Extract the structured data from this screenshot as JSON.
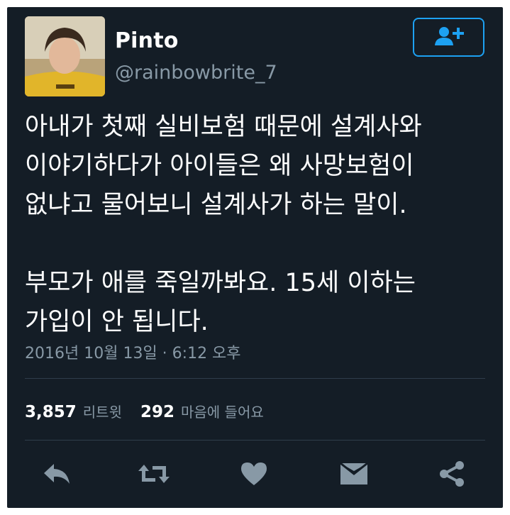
{
  "user": {
    "name": "Pinto",
    "handle": "@rainbowbrite_7"
  },
  "tweet": {
    "text": "아내가 첫째 실비보험 때문에 설계사와\n이야기하다가 아이들은 왜 사망보험이\n없냐고 물어보니 설계사가 하는 말이.\n\n부모가 애를 죽일까봐요. 15세 이하는\n가입이 안 됩니다.",
    "timestamp": "2016년 10월 13일 · 6:12 오후"
  },
  "stats": {
    "retweets_count": "3,857",
    "retweets_label": "리트윗",
    "likes_count": "292",
    "likes_label": "마음에 들어요"
  },
  "icons": {
    "follow": "add-user-icon",
    "reply": "reply-icon",
    "retweet": "retweet-icon",
    "like": "heart-icon",
    "dm": "envelope-icon",
    "share": "share-icon"
  },
  "colors": {
    "background": "#141d26",
    "accent": "#1da1f2",
    "muted": "#8899a6",
    "icon": "#8899a6"
  }
}
